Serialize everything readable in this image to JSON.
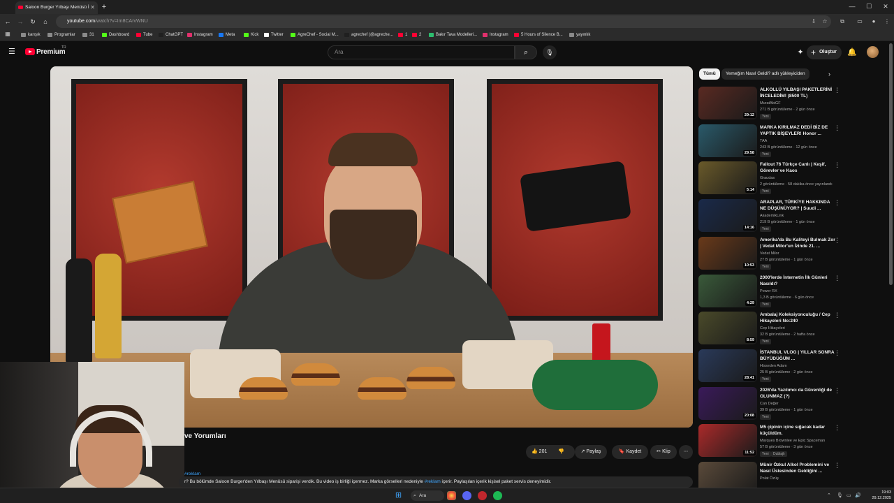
{
  "browser": {
    "tab_title": "Saloon Burger Yılbaşı Menüsü İ",
    "new_tab": "+",
    "url_domain": "youtube.com",
    "url_path": "/watch?v=Im8CArvWNU",
    "window_min": "—",
    "window_max": "☐",
    "window_close": "✕"
  },
  "bookmarks": [
    {
      "label": "karışık",
      "color": "#8a8a8a"
    },
    {
      "label": "Programlar",
      "color": "#8a8a8a"
    },
    {
      "label": "31",
      "color": "#8a8a8a"
    },
    {
      "label": "Dashboard",
      "color": "#53fc18"
    },
    {
      "label": "Tube",
      "color": "#ff0033"
    },
    {
      "label": "ChatGPT",
      "color": "#202020"
    },
    {
      "label": "Instagram",
      "color": "#e1306c"
    },
    {
      "label": "Meta",
      "color": "#1877f2"
    },
    {
      "label": "Kick",
      "color": "#53fc18"
    },
    {
      "label": "Twitter",
      "color": "#ffffff"
    },
    {
      "label": "AgreChef - Social M...",
      "color": "#53fc18"
    },
    {
      "label": "agrechef (@agreche...",
      "color": "#202020"
    },
    {
      "label": "1",
      "color": "#ff0033"
    },
    {
      "label": "2",
      "color": "#ff0033"
    },
    {
      "label": "Bakır Tava Modelleri...",
      "color": "#2dbd6e"
    },
    {
      "label": "Instagram",
      "color": "#e1306c"
    },
    {
      "label": "5 Hours of Silence B...",
      "color": "#ff0033"
    },
    {
      "label": "yayınlık",
      "color": "#8a8a8a"
    }
  ],
  "header": {
    "logo_text": "Premium",
    "logo_tr": "TR",
    "search_placeholder": "Ara",
    "create_label": "Oluştur"
  },
  "video": {
    "title_visible": "ve Yorumları"
  },
  "actions": {
    "like_count": "201",
    "share": "Paylaş",
    "save": "Kaydet",
    "clip": "Klip"
  },
  "description": {
    "tag_top": "#reklam",
    "text_a": "r? Bu bölümde Saloon Burger'den Yılbaşı Menüsü siparişi verdik. Bu video iş birliği içermez. Marka görselleri nedeniyle ",
    "tag": "#reklam",
    "text_b": " içerir. Paylaşılan içerik kişisel paket servis deneyimidir."
  },
  "chips": {
    "all": "Tümü",
    "related": "Yemeğim Nasıl Geldi? adlı yükleyiciden"
  },
  "recommendations": [
    {
      "title": "ALKOLLÜ YILBAŞI PAKETLERİNİ İNCELEDİM! (8500 TL)",
      "channel": "MuratAbiGF",
      "meta": "271 B görüntüleme · 2 gün önce",
      "duration": "29:12",
      "color": "#5a2a22"
    },
    {
      "title": "MARKA KIRILMAZ DEDİ BİZ DE YAPTIK BİŞEYLER! Honor ...",
      "channel": "TAA",
      "meta": "243 B görüntüleme · 12 gün önce",
      "duration": "29:58",
      "color": "#2a5a6a"
    },
    {
      "title": "Fallout 76 Türkçe Canlı | Keşif, Görevler ve Kaos",
      "channel": "Graudas",
      "meta": "2 görüntüleme · 58 dakika önce yayınlandı",
      "duration": "5:14",
      "color": "#6a5a2a"
    },
    {
      "title": "ARAPLAR, TÜRKİYE HAKKINDA NE DÜŞÜNÜYOR? | Suudi ...",
      "channel": "AkademikLink",
      "meta": "219 B görüntüleme · 1 gün önce",
      "duration": "14:16",
      "color": "#1a2a4a"
    },
    {
      "title": "Amerika'da Bu Kaliteyi Bulmak Zor | Vedat Milor'un İzinde 21. ...",
      "channel": "Vedat Milor",
      "meta": "27 B görüntüleme · 1 gün önce",
      "duration": "10:53",
      "color": "#6a3a1a"
    },
    {
      "title": "2000'lerde İnternetin İlk Günleri Nasıldı?",
      "channel": "Power RX",
      "meta": "1,3 B görüntüleme · 6 gün önce",
      "duration": "4:29",
      "color": "#3a5a3a"
    },
    {
      "title": "Ambalaj Koleksiyonculuğu / Cep Hikayeleri No:240",
      "channel": "Cep Hikayeleri",
      "meta": "32 B görüntüleme · 2 hafta önce",
      "duration": "8:59",
      "color": "#4a4a2a"
    },
    {
      "title": "İSTANBUL VLOG | YILLAR SONRA BÜYÜDÜĞÜM ...",
      "channel": "Hisseden Adam",
      "meta": "25 B görüntüleme · 2 gün önce",
      "duration": "28:41",
      "color": "#2a3a5a"
    },
    {
      "title": "2026'da Yazılımcı da Güvenliği de OLUNMAZ (?)",
      "channel": "Can Değer",
      "meta": "39 B görüntüleme · 1 gün önce",
      "duration": "20:08",
      "color": "#3a1a5a"
    },
    {
      "title": "M5 çipinin içine sığacak kadar küçüldüm.",
      "channel": "Marques Brownlee ve Epic Spaceman",
      "meta": "57 B görüntüleme · 3 gün önce",
      "duration": "11:52",
      "color": "#aa2a2a"
    },
    {
      "title": "Münir Özkul Alkol Problemini ve Nasıl Üstesinden Geldiğini ...",
      "channel": "Polat Özüş",
      "meta": "",
      "duration": "",
      "color": "#5a4a3a"
    }
  ],
  "new_badge": "Yeni",
  "dubbed_badge": "Dublajlı",
  "taskbar": {
    "search": "Ara",
    "time": "19:03",
    "date": "29.12.2025"
  }
}
